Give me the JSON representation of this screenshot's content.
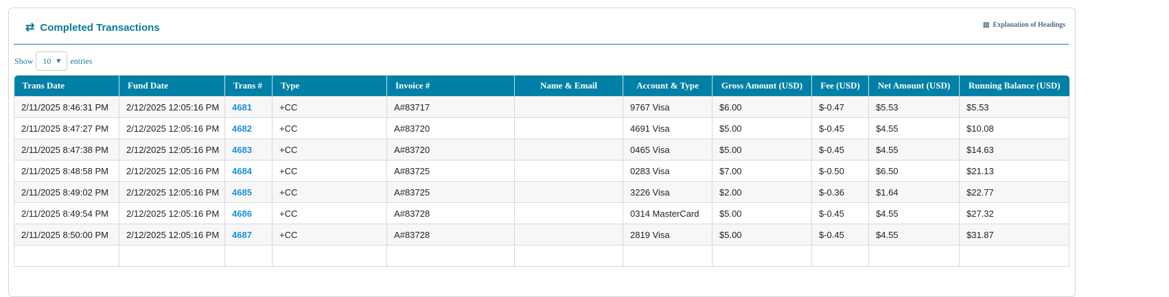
{
  "header": {
    "title": "Completed Transactions",
    "title_icon": "exchange-arrows-icon",
    "explanation_label": "Explanation of Headings",
    "explanation_icon": "list-table-icon"
  },
  "length": {
    "show": "Show",
    "value": "10",
    "entries": "entries"
  },
  "table": {
    "columns": [
      "Trans Date",
      "Fund Date",
      "Trans #",
      "Type",
      "Invoice #",
      "Name & Email",
      "Account & Type",
      "Gross Amount (USD)",
      "Fee (USD)",
      "Net Amount (USD)",
      "Running Balance (USD)"
    ],
    "rows": [
      [
        "2/11/2025 8:46:31 PM",
        "2/12/2025 12:05:16 PM",
        "4681",
        "+CC",
        "A#83717",
        "",
        "9767 Visa",
        "$6.00",
        "$-0.47",
        "$5.53",
        "$5.53"
      ],
      [
        "2/11/2025 8:47:27 PM",
        "2/12/2025 12:05:16 PM",
        "4682",
        "+CC",
        "A#83720",
        "",
        "4691 Visa",
        "$5.00",
        "$-0.45",
        "$4.55",
        "$10.08"
      ],
      [
        "2/11/2025 8:47:38 PM",
        "2/12/2025 12:05:16 PM",
        "4683",
        "+CC",
        "A#83720",
        "",
        "0465 Visa",
        "$5.00",
        "$-0.45",
        "$4.55",
        "$14.63"
      ],
      [
        "2/11/2025 8:48:58 PM",
        "2/12/2025 12:05:16 PM",
        "4684",
        "+CC",
        "A#83725",
        "",
        "0283 Visa",
        "$7.00",
        "$-0.50",
        "$6.50",
        "$21.13"
      ],
      [
        "2/11/2025 8:49:02 PM",
        "2/12/2025 12:05:16 PM",
        "4685",
        "+CC",
        "A#83725",
        "",
        "3226 Visa",
        "$2.00",
        "$-0.36",
        "$1.64",
        "$22.77"
      ],
      [
        "2/11/2025 8:49:54 PM",
        "2/12/2025 12:05:16 PM",
        "4686",
        "+CC",
        "A#83728",
        "",
        "0314 MasterCard",
        "$5.00",
        "$-0.45",
        "$4.55",
        "$27.32"
      ],
      [
        "2/11/2025 8:50:00 PM",
        "2/12/2025 12:05:16 PM",
        "4687",
        "+CC",
        "A#83728",
        "",
        "2819 Visa",
        "$5.00",
        "$-0.45",
        "$4.55",
        "$31.87"
      ]
    ]
  }
}
